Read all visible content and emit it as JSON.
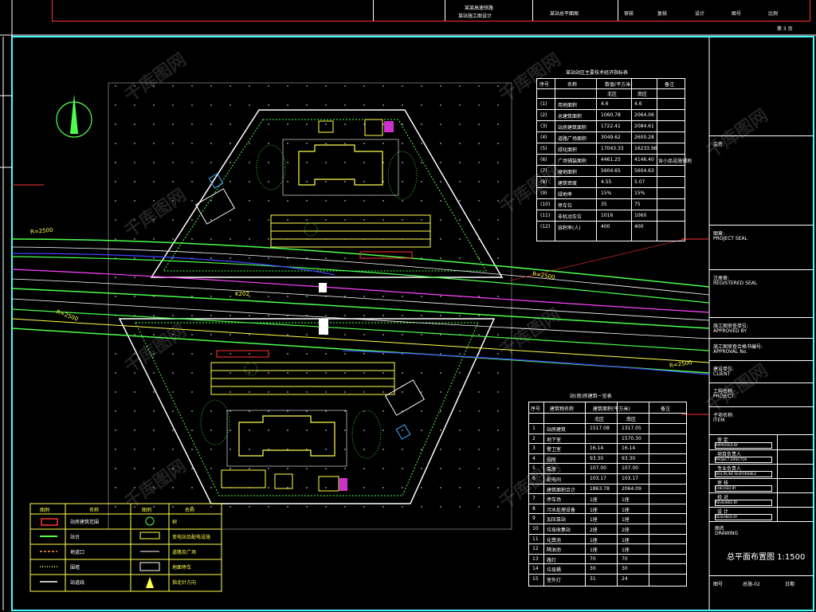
{
  "titlebar": {
    "project_line1": "某某高速铁路",
    "project_line2": "某站施工图设计",
    "drawing_name": "某站总平面图",
    "cells": [
      "审核",
      "复核",
      "设计",
      "图号",
      "比例"
    ],
    "page": "第 3 页"
  },
  "stats_table": {
    "title": "某站站区主要技术经济指标表",
    "headers": [
      "序号",
      "名称",
      "数值(平方米)",
      "备注"
    ],
    "subheaders": [
      "北区",
      "南区"
    ],
    "rows": [
      {
        "no": "(1)",
        "name": "用地面积",
        "a": "4.6",
        "b": "4.6",
        "note": ""
      },
      {
        "no": "(2)",
        "name": "总建筑面积",
        "a": "1060.78",
        "b": "2064.06",
        "note": ""
      },
      {
        "no": "(3)",
        "name": "站房建筑面积",
        "a": "1722.41",
        "b": "2084.61",
        "note": ""
      },
      {
        "no": "(4)",
        "name": "道路广场面积",
        "a": "3049.62",
        "b": "2600.28",
        "note": ""
      },
      {
        "no": "(5)",
        "name": "绿化面积",
        "a": "17043.33",
        "b": "16233.96",
        "note": ""
      },
      {
        "no": "(6)",
        "name": "广场铺装面积",
        "a": "4461.25",
        "b": "4146.40",
        "note": "含小品设施铺地"
      },
      {
        "no": "(7)",
        "name": "硬地面积",
        "a": "5604.65",
        "b": "5604.63",
        "note": ""
      },
      {
        "no": "(8)",
        "name": "建筑密度",
        "a": "4.55",
        "b": "5.07",
        "note": ""
      },
      {
        "no": "(9)",
        "name": "绿地率",
        "a": "15%",
        "b": "15%",
        "note": ""
      },
      {
        "no": "(10)",
        "name": "停车位",
        "a": "35",
        "b": "75",
        "note": ""
      },
      {
        "no": "(11)",
        "name": "非机动车位",
        "a": "1016",
        "b": "1060",
        "note": ""
      },
      {
        "no": "(12)",
        "name": "容积率(人)",
        "a": "400",
        "b": "400",
        "note": ""
      }
    ]
  },
  "buildings_table": {
    "title": "站(南)房建筑一览表",
    "headers": [
      "序号",
      "建筑物名称",
      "建筑面积(平方米)",
      "备注"
    ],
    "subheaders": [
      "北区",
      "南区"
    ],
    "rows": [
      {
        "no": "1",
        "name": "站房建筑",
        "a": "1517.08",
        "b": "1317.05"
      },
      {
        "no": "2",
        "name": "地下室",
        "a": "",
        "b": "1570.30"
      },
      {
        "no": "3",
        "name": "警卫室",
        "a": "16.14",
        "b": "16.14"
      },
      {
        "no": "4",
        "name": "厕所",
        "a": "93.30",
        "b": "93.30"
      },
      {
        "no": "5",
        "name": "泵房",
        "a": "107.00",
        "b": "107.00"
      },
      {
        "no": "6",
        "name": "配电间",
        "a": "103.17",
        "b": "103.17"
      },
      {
        "no": "",
        "name": "建筑面积合计",
        "a": "1863.78",
        "b": "2064.09"
      },
      {
        "no": "7",
        "name": "停车场",
        "a": "1座",
        "b": "1座"
      },
      {
        "no": "8",
        "name": "污水处理设备",
        "a": "1座",
        "b": "1座"
      },
      {
        "no": "9",
        "name": "加压泵站",
        "a": "1座",
        "b": "1座"
      },
      {
        "no": "10",
        "name": "垃圾收集站",
        "a": "2座",
        "b": "2座"
      },
      {
        "no": "11",
        "name": "化粪池",
        "a": "1座",
        "b": "1座"
      },
      {
        "no": "12",
        "name": "隔油池",
        "a": "1座",
        "b": "1座"
      },
      {
        "no": "13",
        "name": "路灯",
        "a": "70",
        "b": "70"
      },
      {
        "no": "14",
        "name": "垃圾桶",
        "a": "30",
        "b": "30"
      },
      {
        "no": "15",
        "name": "室外灯",
        "a": "31",
        "b": "24"
      }
    ]
  },
  "legend": {
    "headers": [
      "图例",
      "名称",
      "图例",
      "名称"
    ],
    "rows": [
      {
        "name_left": "站房建筑范围",
        "name_right": "树"
      },
      {
        "name_left": "站台",
        "name_right": "变电站及配电设施"
      },
      {
        "name_left": "地道口",
        "name_right": "道路及广场"
      },
      {
        "name_left": "围墙",
        "name_right": "地面停车"
      },
      {
        "name_left": "站道线",
        "name_right": "指北针方向"
      }
    ]
  },
  "right_panel": {
    "sections": [
      {
        "label": "会签:"
      },
      {
        "label": "图章:",
        "sub": "PROJECT SEAL"
      },
      {
        "label": "注册章:",
        "sub": "REGISTERED SEAL"
      },
      {
        "label": "施工图审查单位:",
        "sub": "APPROVED BY"
      },
      {
        "label": "施工图审查合格书编号:",
        "sub": "APPROVAL No."
      },
      {
        "label": "建设单位:",
        "sub": "CLIENT"
      },
      {
        "label": "工程名称:",
        "sub": "PROJECT"
      },
      {
        "label": "子项名称:",
        "sub": "ITEM"
      }
    ],
    "signature_rows": [
      "审 定",
      "项目负责人",
      "专业负责人",
      "审 核",
      "校 对",
      "设 计"
    ],
    "sig_sub": [
      "APPROVED BY",
      "PROJECT DIRECTOR",
      "DISCIPLINE RESPONSIBLE",
      "CHECKED BY",
      "REVIEWED BY",
      "DESIGNED BY"
    ],
    "drawing_label": "图名",
    "drawing_label_sub": "DRAWING",
    "drawing_title": "总平面布置图 1:1500",
    "drawing_no_label": "图号",
    "drawing_no": "总施-02",
    "date_label": "日期"
  },
  "plan": {
    "labels": {
      "radius_left": "R=2500",
      "radius_right": "R=2500",
      "radius_lower": "R=2500",
      "radius_lower_right": "R=2500",
      "mileage": "K202"
    },
    "north_arrow": "north-arrow-icon"
  },
  "watermark": "千库图网",
  "colors": {
    "frame": "#44ffff",
    "green": "#4cff4c",
    "yellow": "#ffff4c",
    "red": "#ff3333",
    "magenta": "#ff44ff",
    "white": "#ffffff"
  }
}
